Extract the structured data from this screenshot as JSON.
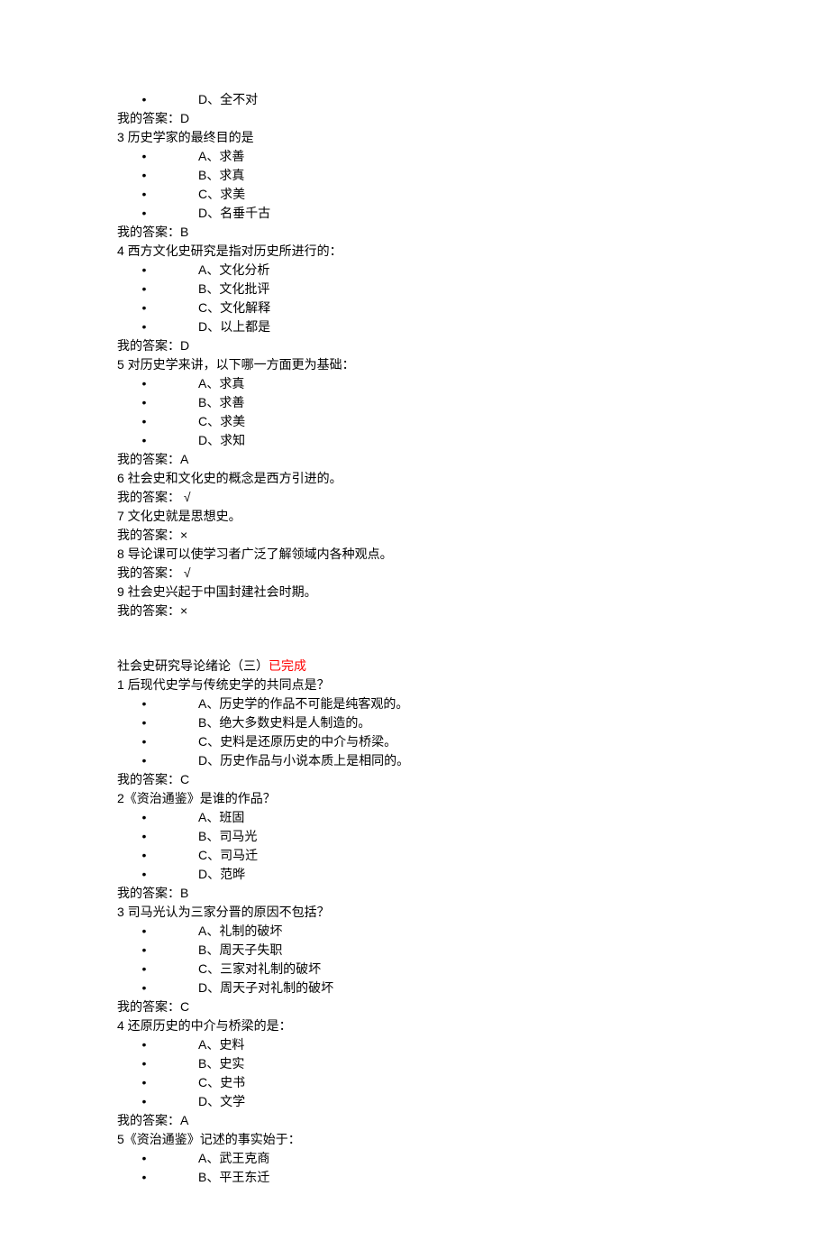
{
  "bullet": "•",
  "blocks": [
    {
      "type": "option",
      "text": "D、全不对"
    },
    {
      "type": "statement",
      "text": "我的答案：D"
    },
    {
      "type": "statement",
      "text": "3 历史学家的最终目的是"
    },
    {
      "type": "option",
      "text": "A、求善"
    },
    {
      "type": "option",
      "text": "B、求真"
    },
    {
      "type": "option",
      "text": "C、求美"
    },
    {
      "type": "option",
      "text": "D、名垂千古"
    },
    {
      "type": "statement",
      "text": "我的答案：B"
    },
    {
      "type": "statement",
      "text": "4 西方文化史研究是指对历史所进行的："
    },
    {
      "type": "option",
      "text": "A、文化分析"
    },
    {
      "type": "option",
      "text": "B、文化批评"
    },
    {
      "type": "option",
      "text": "C、文化解释"
    },
    {
      "type": "option",
      "text": "D、以上都是"
    },
    {
      "type": "statement",
      "text": "我的答案：D"
    },
    {
      "type": "statement",
      "text": "5 对历史学来讲，以下哪一方面更为基础："
    },
    {
      "type": "option",
      "text": "A、求真"
    },
    {
      "type": "option",
      "text": "B、求善"
    },
    {
      "type": "option",
      "text": "C、求美"
    },
    {
      "type": "option",
      "text": "D、求知"
    },
    {
      "type": "statement",
      "text": "我的答案：A"
    },
    {
      "type": "statement",
      "text": "6 社会史和文化史的概念是西方引进的。"
    },
    {
      "type": "statement",
      "text": "我的答案： √"
    },
    {
      "type": "statement",
      "text": "7 文化史就是思想史。"
    },
    {
      "type": "statement",
      "text": "我的答案：×"
    },
    {
      "type": "statement",
      "text": "8 导论课可以使学习者广泛了解领域内各种观点。"
    },
    {
      "type": "statement",
      "text": "我的答案： √"
    },
    {
      "type": "statement",
      "text": "9 社会史兴起于中国封建社会时期。"
    },
    {
      "type": "statement",
      "text": "我的答案：×"
    },
    {
      "type": "section",
      "text": "社会史研究导论绪论（三）",
      "suffix": "已完成"
    },
    {
      "type": "statement",
      "text": "1 后现代史学与传统史学的共同点是？"
    },
    {
      "type": "option",
      "text": "A、历史学的作品不可能是纯客观的。"
    },
    {
      "type": "option",
      "text": "B、绝大多数史料是人制造的。"
    },
    {
      "type": "option",
      "text": "C、史料是还原历史的中介与桥梁。"
    },
    {
      "type": "option",
      "text": "D、历史作品与小说本质上是相同的。"
    },
    {
      "type": "statement",
      "text": "我的答案：C"
    },
    {
      "type": "statement",
      "text": "2《资治通鉴》是谁的作品？"
    },
    {
      "type": "option",
      "text": "A、班固"
    },
    {
      "type": "option",
      "text": "B、司马光"
    },
    {
      "type": "option",
      "text": "C、司马迁"
    },
    {
      "type": "option",
      "text": "D、范晔"
    },
    {
      "type": "statement",
      "text": "我的答案：B"
    },
    {
      "type": "statement",
      "text": "3 司马光认为三家分晋的原因不包括？"
    },
    {
      "type": "option",
      "text": "A、礼制的破坏"
    },
    {
      "type": "option",
      "text": "B、周天子失职"
    },
    {
      "type": "option",
      "text": "C、三家对礼制的破坏"
    },
    {
      "type": "option",
      "text": "D、周天子对礼制的破坏"
    },
    {
      "type": "statement",
      "text": "我的答案：C"
    },
    {
      "type": "statement",
      "text": "4 还原历史的中介与桥梁的是："
    },
    {
      "type": "option",
      "text": "A、史料"
    },
    {
      "type": "option",
      "text": "B、史实"
    },
    {
      "type": "option",
      "text": "C、史书"
    },
    {
      "type": "option",
      "text": "D、文学"
    },
    {
      "type": "statement",
      "text": "我的答案：A"
    },
    {
      "type": "statement",
      "text": "5《资治通鉴》记述的事实始于："
    },
    {
      "type": "option",
      "text": "A、武王克商"
    },
    {
      "type": "option",
      "text": "B、平王东迁"
    }
  ]
}
